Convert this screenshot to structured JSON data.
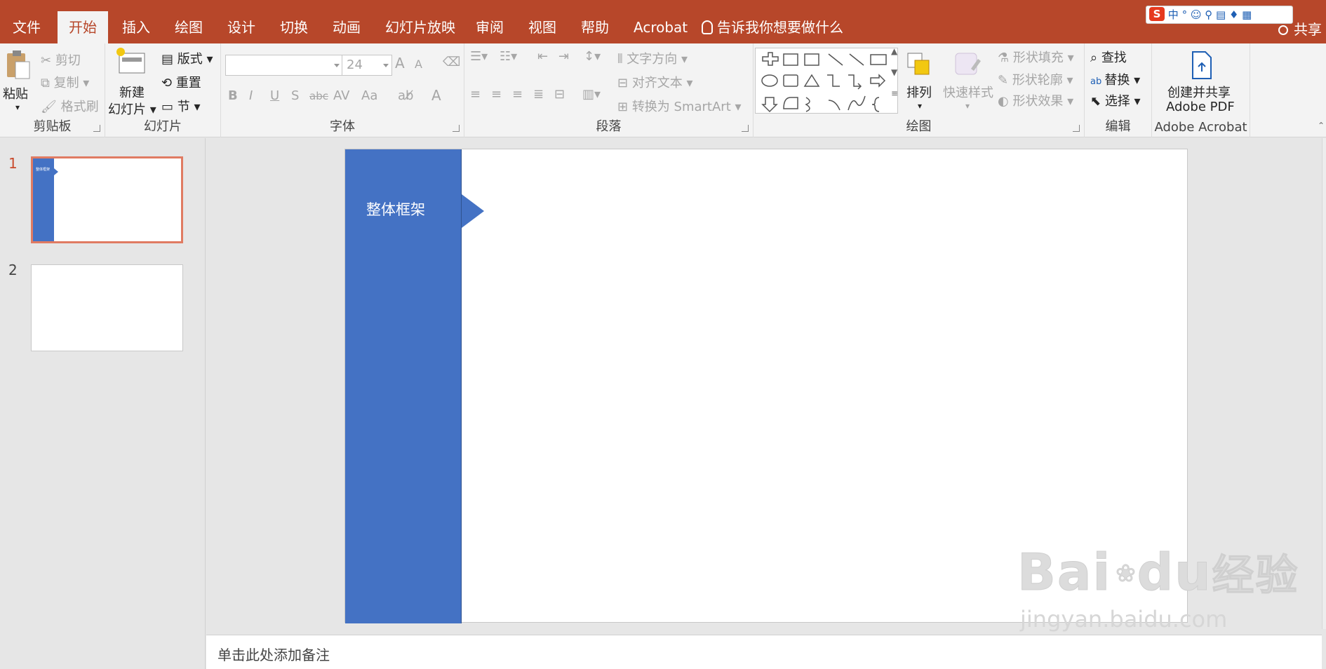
{
  "tabs": [
    "文件",
    "开始",
    "插入",
    "绘图",
    "设计",
    "切换",
    "动画",
    "幻灯片放映",
    "审阅",
    "视图",
    "帮助",
    "Acrobat"
  ],
  "active_tab": "开始",
  "tell_me": "告诉我你想要做什么",
  "share": "共享",
  "ime_label": "中",
  "ribbon": {
    "clipboard": {
      "paste": "粘贴",
      "cut": "剪切",
      "copy": "复制",
      "format_painter": "格式刷",
      "label": "剪贴板"
    },
    "slides": {
      "new_slide_1": "新建",
      "new_slide_2": "幻灯片",
      "layout": "版式",
      "reset": "重置",
      "section": "节",
      "label": "幻灯片"
    },
    "font": {
      "size": "24",
      "bold": "B",
      "italic": "I",
      "underline": "U",
      "shadow": "S",
      "strike": "abc",
      "spacing": "AV",
      "case": "Aa",
      "grow": "A",
      "shrink": "A",
      "color": "A",
      "label": "字体"
    },
    "paragraph": {
      "text_direction": "文字方向",
      "align_text": "对齐文本",
      "smartart": "转换为 SmartArt",
      "label": "段落"
    },
    "drawing": {
      "arrange": "排列",
      "quick_styles": "快速样式",
      "fill": "形状填充",
      "outline": "形状轮廓",
      "effects": "形状效果",
      "label": "绘图"
    },
    "editing": {
      "find": "查找",
      "replace": "替换",
      "select": "选择",
      "label": "编辑"
    },
    "acrobat": {
      "create_1": "创建并共享",
      "create_2": "Adobe PDF",
      "label": "Adobe Acrobat"
    }
  },
  "thumbnails": [
    {
      "number": "1",
      "text": "整体框架"
    },
    {
      "number": "2"
    }
  ],
  "slide": {
    "bar_text": "整体框架"
  },
  "notes_placeholder": "单击此处添加备注",
  "watermark": {
    "big": "Bai",
    "du": "du",
    "cn": "经验",
    "url": "jingyan.baidu.com"
  },
  "colors": {
    "titlebar": "#b7472a",
    "accent": "#4472c4",
    "selection": "#e07b62"
  }
}
